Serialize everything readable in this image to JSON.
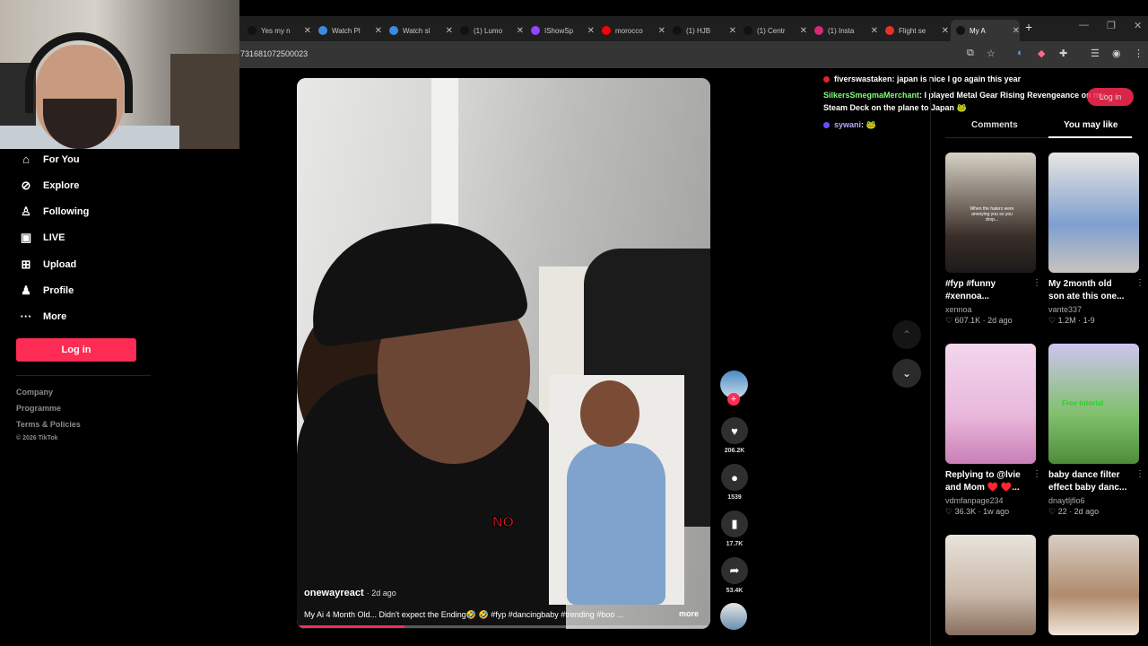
{
  "browser": {
    "tabs": [
      {
        "label": "Yes my n",
        "color": "#111111"
      },
      {
        "label": "Watch Pl",
        "color": "#3a8dde"
      },
      {
        "label": "Watch sl",
        "color": "#3a8dde"
      },
      {
        "label": "(1) Lumo",
        "color": "#111111"
      },
      {
        "label": "IShowSp",
        "color": "#9146ff"
      },
      {
        "label": "morocco",
        "color": "#ff0000"
      },
      {
        "label": "(1) HJB",
        "color": "#111111"
      },
      {
        "label": "(1) Centr",
        "color": "#111111"
      },
      {
        "label": "(1) Insta",
        "color": "#d62976"
      },
      {
        "label": "Flight se",
        "color": "#e5322d"
      },
      {
        "label": "My A",
        "color": "#111111"
      }
    ],
    "url_fragment": "731681072500023",
    "new_tab": "+"
  },
  "sidebar": {
    "items": [
      {
        "label": "For You",
        "icon": "home-icon"
      },
      {
        "label": "Explore",
        "icon": "compass-icon"
      },
      {
        "label": "Following",
        "icon": "user-follow-icon"
      },
      {
        "label": "LIVE",
        "icon": "live-icon"
      },
      {
        "label": "Upload",
        "icon": "plus-square-icon"
      },
      {
        "label": "Profile",
        "icon": "person-icon"
      },
      {
        "label": "More",
        "icon": "ellipsis-icon"
      }
    ],
    "login": "Log in",
    "footer": {
      "company": "Company",
      "programme": "Programme",
      "terms": "Terms & Policies",
      "copyright": "© 2026 TikTok"
    }
  },
  "video": {
    "username": "onewayreact",
    "date": "· 2d ago",
    "caption": "My Ai 4 Month Old... Didn't expect the Ending🤣 🤣 #fyp #dancingbaby #trending #boo ...",
    "more": "more",
    "overlay_text": "NO",
    "progress": 0.26,
    "accent_color": "#fe2c55"
  },
  "actions": {
    "likes": "206.2K",
    "comments": "1539",
    "saves": "17.7K",
    "shares": "53.4K"
  },
  "chat": [
    {
      "user": "fiverswastaken",
      "text": ": japan is nice I go again this year",
      "user_color": "#ffffff",
      "dot": "#e02424"
    },
    {
      "user": "SilkersSmegmaMerchant",
      "text": ": I played Metal Gear Rising Revengeance on my Steam Deck on the plane to Japan 🐸",
      "user_color": "#7dff7d",
      "dot": ""
    },
    {
      "user": "sywani",
      "text": ": 🐸",
      "user_color": "#b9a6ff",
      "dot": "#6a4cff"
    }
  ],
  "right_panel": {
    "tab_comments": "Comments",
    "tab_you_may_like": "You may like",
    "login_ghost": "Log in",
    "cards": [
      {
        "title": "#fyp #funny",
        "title2": "#xennoa...",
        "author": "xennoa",
        "likes": "607.1K",
        "when": "2d ago",
        "thumb_text": "When the haters were annoying you so you drop..."
      },
      {
        "title": "My 2month old",
        "title2": "son ate this one...",
        "author": "vante337",
        "likes": "1.2M",
        "when": "1-9",
        "thumb_text": ""
      },
      {
        "title": "Replying to @lvie",
        "title2": "and Mom ♥️ ♥️...",
        "author": "vdmfanpage234",
        "likes": "36.3K",
        "when": "1w ago",
        "thumb_text": ""
      },
      {
        "title": "baby dance filter",
        "title2": "effect baby danc...",
        "author": "dnaytljfio6",
        "likes": "22",
        "when": "2d ago",
        "thumb_text": "Free tutorial"
      },
      {
        "title": "",
        "title2": "",
        "author": "",
        "likes": "",
        "when": "",
        "thumb_text": ""
      },
      {
        "title": "",
        "title2": "",
        "author": "",
        "likes": "",
        "when": "",
        "thumb_text": ""
      }
    ]
  }
}
